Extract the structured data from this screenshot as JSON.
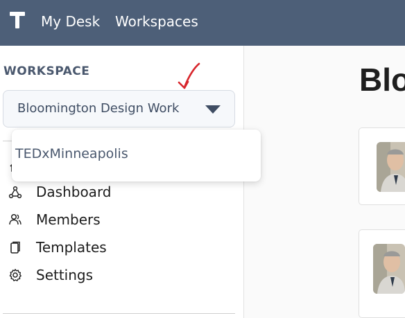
{
  "topbar": {
    "logo_icon": "t-logo-icon",
    "nav": [
      "My Desk",
      "Workspaces"
    ]
  },
  "sidebar": {
    "workspace_heading": "WORKSPACE",
    "workspace_selected": "Bloomington Design Work",
    "menu": [
      {
        "label": "Dashboard",
        "icon": "dashboard-icon"
      },
      {
        "label": "Members",
        "icon": "members-icon"
      },
      {
        "label": "Templates",
        "icon": "templates-icon"
      },
      {
        "label": "Settings",
        "icon": "gear-icon"
      }
    ]
  },
  "dropdown": {
    "options": [
      "TEDxMinneapolis"
    ]
  },
  "main": {
    "title": "Blo"
  },
  "colors": {
    "topbar": "#4d5f78",
    "annotation": "#d8262c"
  }
}
